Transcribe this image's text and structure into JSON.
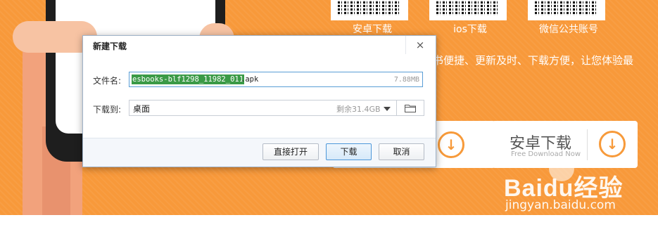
{
  "background_page": {
    "qr_labels": [
      "安卓下载",
      "ios下载",
      "微信公共账号"
    ],
    "slogan": "搜书便捷、更新及时、下载方便，让您体验最",
    "download_button": {
      "title": "安卓下载",
      "subtitle": "Free Download Now"
    },
    "watermark": {
      "logo_text": "Baidu经验",
      "url": "jingyan.baidu.com"
    },
    "colors": {
      "orange": "#f8993a",
      "white": "#ffffff"
    }
  },
  "dialog": {
    "title": "新建下载",
    "close_icon": "×",
    "filename_label": "文件名:",
    "filename_selected": "esbooks-blf1298_11982_011",
    "filename_ext": ".apk",
    "file_size": "7.88MB",
    "saveto_label": "下载到:",
    "save_path": "桌面",
    "free_space": "剩余31.4GB",
    "buttons": {
      "open_directly": "直接打开",
      "download": "下载",
      "cancel": "取消"
    },
    "colors": {
      "selection": "#3a9a46",
      "focus_border": "#5a9ed6"
    }
  }
}
